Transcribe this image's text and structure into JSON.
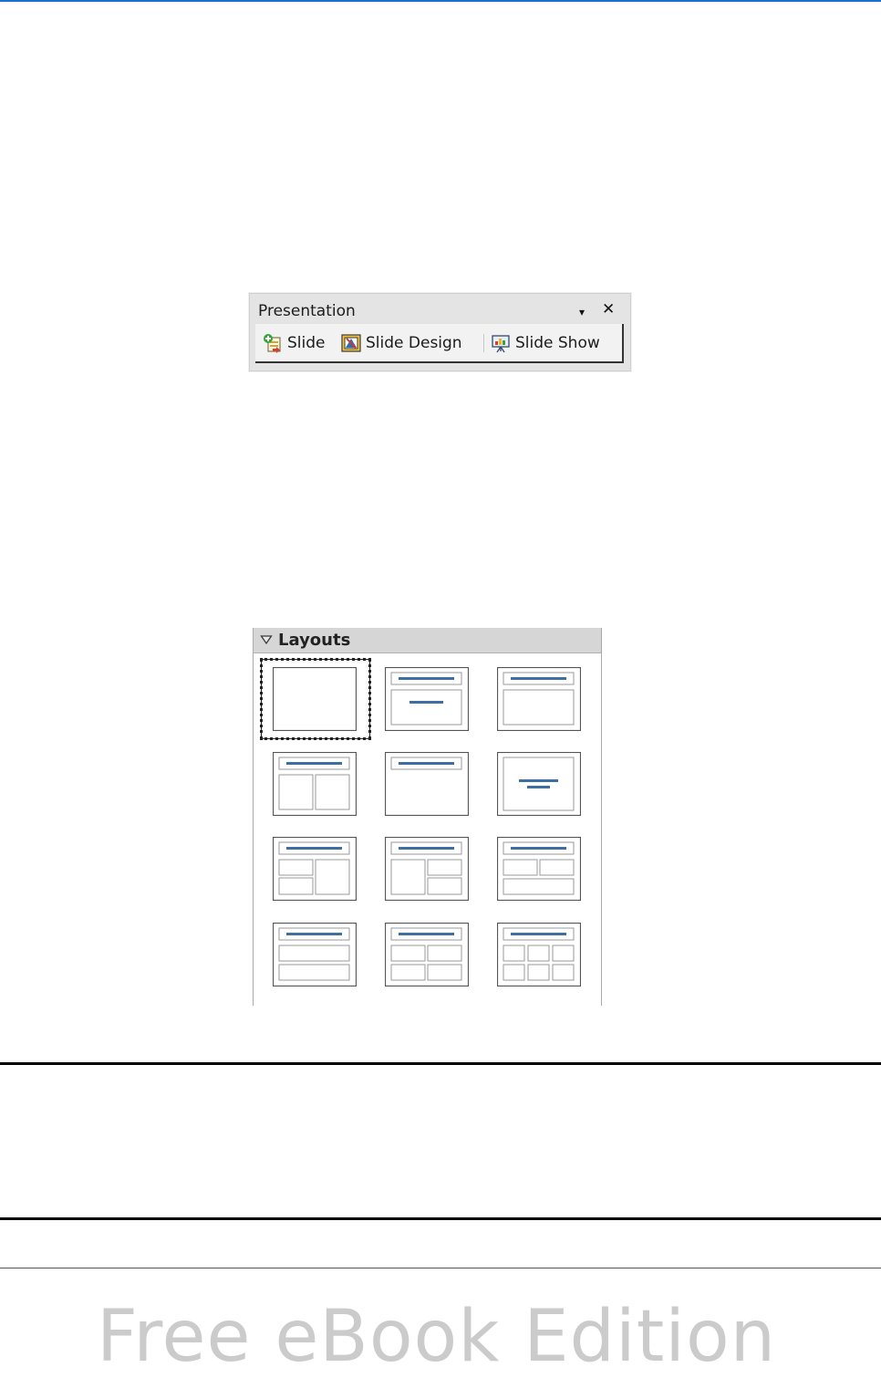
{
  "toolbar": {
    "title": "Presentation",
    "dropdown_glyph": "▾",
    "close_glyph": "✕",
    "buttons": [
      {
        "label": "Slide",
        "icon": "new-slide-icon"
      },
      {
        "label": "Slide Design",
        "icon": "slide-design-icon"
      },
      {
        "label": "Slide Show",
        "icon": "slide-show-icon"
      }
    ]
  },
  "layouts_panel": {
    "title": "Layouts",
    "items": [
      "blank-slide",
      "title-slide",
      "title-content",
      "title-2-content",
      "title-only",
      "centered-text",
      "title-2-content-and-content",
      "title-content-and-2-content",
      "title-2-content-over-content",
      "title-content-over-content",
      "title-2-content-over-2-content",
      "title-6-content"
    ],
    "selected_index": 0
  },
  "footer": {
    "watermark": "Free eBook Edition"
  },
  "colors": {
    "accent_line": "#1a73c8",
    "layout_bar": "#3d6fa3"
  }
}
